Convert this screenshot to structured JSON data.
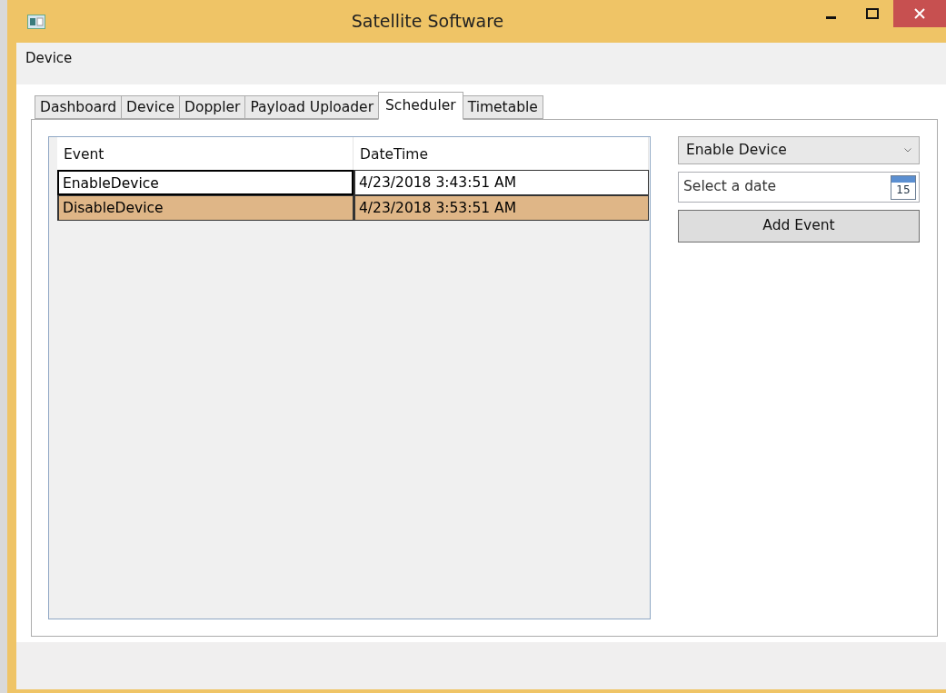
{
  "window": {
    "title": "Satellite Software"
  },
  "menu": [
    {
      "label": "Device"
    }
  ],
  "tabs": [
    {
      "label": "Dashboard",
      "selected": false
    },
    {
      "label": "Device",
      "selected": false
    },
    {
      "label": "Doppler",
      "selected": false
    },
    {
      "label": "Payload Uploader",
      "selected": false
    },
    {
      "label": "Scheduler",
      "selected": true
    },
    {
      "label": "Timetable",
      "selected": false
    }
  ],
  "table": {
    "columns": [
      "Event",
      "DateTime"
    ],
    "rows": [
      {
        "cells": [
          "EnableDevice",
          "4/23/2018 3:43:51 AM"
        ],
        "selected": false,
        "focused": true
      },
      {
        "cells": [
          "DisableDevice",
          "4/23/2018 3:53:51 AM"
        ],
        "selected": true,
        "focused": false
      }
    ]
  },
  "event_select": {
    "value": "Enable Device"
  },
  "date_field": {
    "placeholder": "Select a date",
    "calendar_day": "15"
  },
  "add_button": {
    "label": "Add Event"
  }
}
